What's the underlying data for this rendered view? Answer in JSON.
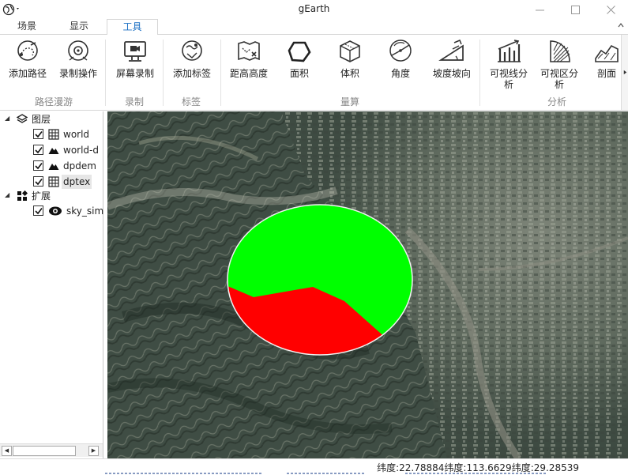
{
  "window": {
    "title": "gEarth"
  },
  "tabs": [
    {
      "label": "场景"
    },
    {
      "label": "显示"
    },
    {
      "label": "工具"
    }
  ],
  "ribbon": {
    "buttons": [
      {
        "label": "添加路径",
        "icon": "add-path-icon"
      },
      {
        "label": "录制操作",
        "icon": "record-op-icon"
      },
      {
        "label": "屏幕录制",
        "icon": "screen-record-icon"
      },
      {
        "label": "添加标签",
        "icon": "add-label-icon"
      },
      {
        "label": "距高高度",
        "icon": "distance-height-icon"
      },
      {
        "label": "面积",
        "icon": "area-icon"
      },
      {
        "label": "体积",
        "icon": "volume-icon"
      },
      {
        "label": "角度",
        "icon": "angle-icon"
      },
      {
        "label": "坡度坡向",
        "icon": "slope-icon"
      },
      {
        "label": "可视线分",
        "label2": "析",
        "icon": "sightline-icon"
      },
      {
        "label": "可视区分",
        "label2": "析",
        "icon": "viewshed-icon"
      },
      {
        "label": "剖面",
        "icon": "profile-icon"
      }
    ],
    "groups": [
      {
        "label": "路径漫游"
      },
      {
        "label": "录制"
      },
      {
        "label": "标签"
      },
      {
        "label": "量算"
      },
      {
        "label": "分析"
      }
    ]
  },
  "layers": {
    "groups": [
      {
        "label": "图层",
        "icon": "layers-icon",
        "items": [
          {
            "label": "world",
            "icon": "grid-icon",
            "checked": true
          },
          {
            "label": "world-d",
            "icon": "terrain-icon",
            "checked": true
          },
          {
            "label": "dpdem",
            "icon": "terrain-icon",
            "checked": true
          },
          {
            "label": "dptex",
            "icon": "grid-icon",
            "checked": true,
            "selected": true
          }
        ]
      },
      {
        "label": "扩展",
        "icon": "extension-icon",
        "items": [
          {
            "label": "sky_sim",
            "icon": "sky-icon",
            "checked": true
          }
        ]
      }
    ]
  },
  "viewshed": {
    "visible_color": "#00ff00",
    "invisible_color": "#ff0000"
  },
  "status": {
    "coords": "纬度:22.78884纬度:113.6629纬度:29.28539"
  },
  "colors": {
    "accent": "#1a6fc4",
    "visible": "#00ff00",
    "invisible": "#ff0000"
  }
}
